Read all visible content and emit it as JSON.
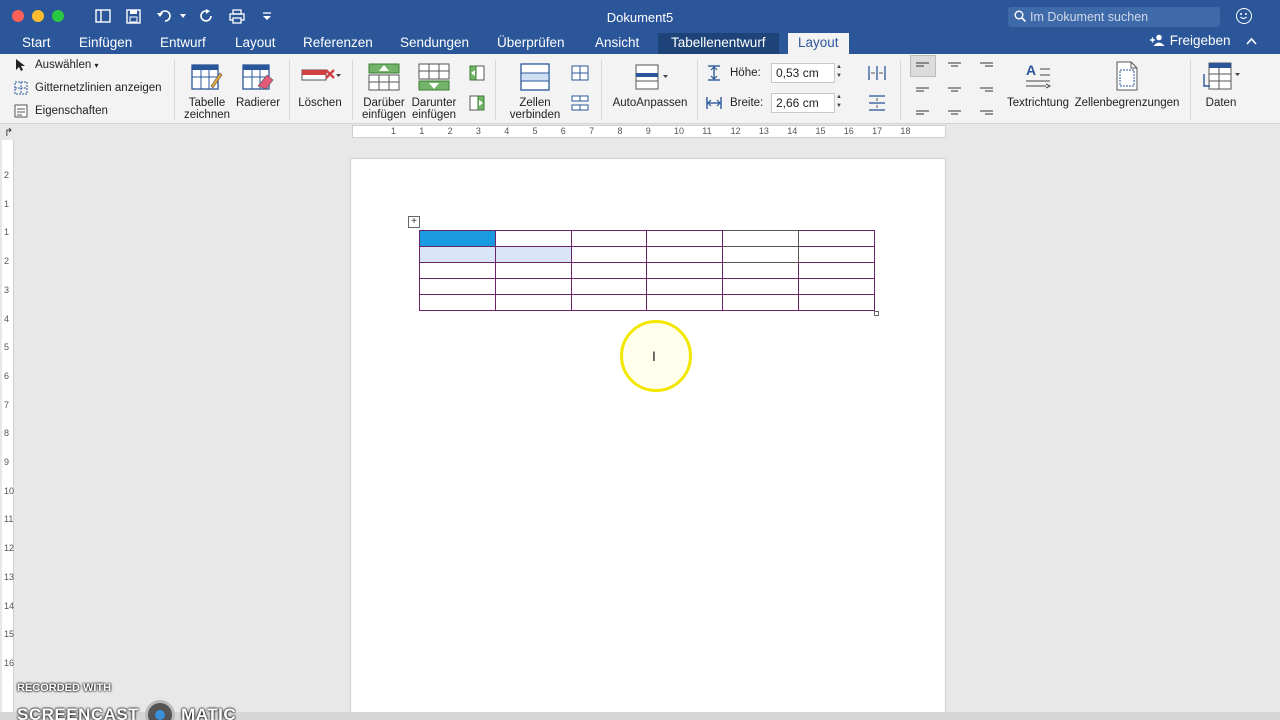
{
  "window": {
    "title": "Dokument5",
    "search_placeholder": "Im Dokument suchen"
  },
  "tabs": [
    {
      "label": "Start"
    },
    {
      "label": "Einfügen"
    },
    {
      "label": "Entwurf"
    },
    {
      "label": "Layout"
    },
    {
      "label": "Referenzen"
    },
    {
      "label": "Sendungen"
    },
    {
      "label": "Überprüfen"
    },
    {
      "label": "Ansicht"
    },
    {
      "label": "Tabellenentwurf"
    },
    {
      "label": "Layout"
    }
  ],
  "active_tab": "Layout",
  "share_label": "Freigeben",
  "ribbon": {
    "select": "Auswählen",
    "gridlines": "Gitternetzlinien anzeigen",
    "properties": "Eigenschaften",
    "draw_table_1": "Tabelle",
    "draw_table_2": "zeichnen",
    "eraser": "Radierer",
    "delete": "Löschen",
    "insert_above_1": "Darüber",
    "insert_above_2": "einfügen",
    "insert_below_1": "Darunter",
    "insert_below_2": "einfügen",
    "merge_1": "Zellen",
    "merge_2": "verbinden",
    "autofit": "AutoAnpassen",
    "height_label": "Höhe:",
    "height_value": "0,53 cm",
    "width_label": "Breite:",
    "width_value": "2,66 cm",
    "text_direction": "Textrichtung",
    "cell_margins": "Zellenbegrenzungen",
    "data": "Daten"
  },
  "ruler": {
    "h_labels": [
      "1",
      "1",
      "2",
      "3",
      "4",
      "5",
      "6",
      "7",
      "8",
      "9",
      "10",
      "11",
      "12",
      "13",
      "14",
      "15",
      "16",
      "17",
      "18"
    ],
    "v_labels": [
      "2",
      "1",
      "1",
      "2",
      "3",
      "4",
      "5",
      "6",
      "7",
      "8",
      "9",
      "10",
      "11",
      "12",
      "13",
      "14",
      "15",
      "16"
    ]
  },
  "table": {
    "rows": 5,
    "cols": 6
  },
  "watermark": {
    "line1": "RECORDED WITH",
    "left": "SCREENCAST",
    "right": "MATIC"
  },
  "colors": {
    "brand": "#2b579a",
    "table_border": "#6b2467",
    "selected_cell": "#1a9ae0",
    "cursor_highlight": "#f3e700"
  }
}
